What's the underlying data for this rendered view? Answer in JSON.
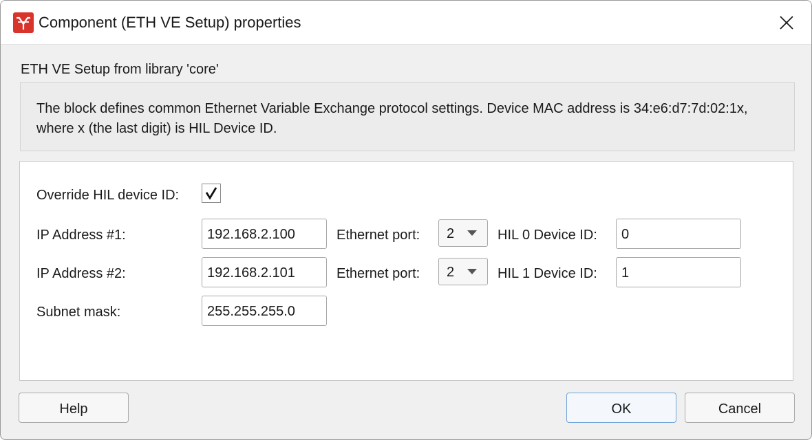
{
  "window": {
    "title": "Component (ETH VE Setup) properties",
    "library_label": "ETH VE Setup from library 'core'",
    "description": "The block defines common Ethernet Variable Exchange protocol settings. Device MAC address is 34:e6:d7:7d:02:1x, where x (the last digit) is HIL Device ID.",
    "icons": {
      "app": "typhoon-logo-icon",
      "close": "close-icon",
      "check": "checkmark-icon",
      "dropdown": "chevron-down-icon"
    },
    "colors": {
      "app_icon": "#d9342b",
      "default_button_border": "#6fa3d8"
    }
  },
  "form": {
    "override_label": "Override HIL device ID:",
    "override_checked": true,
    "ip1": {
      "label": "IP Address #1:",
      "value": "192.168.2.100"
    },
    "ip2": {
      "label": "IP Address #2:",
      "value": "192.168.2.101"
    },
    "subnet": {
      "label": "Subnet mask:",
      "value": "255.255.255.0"
    },
    "port1": {
      "label": "Ethernet port:",
      "value": "2"
    },
    "port2": {
      "label": "Ethernet port:",
      "value": "2"
    },
    "hil0": {
      "label": "HIL 0 Device ID:",
      "value": "0"
    },
    "hil1": {
      "label": "HIL 1 Device ID:",
      "value": "1"
    }
  },
  "buttons": {
    "help": "Help",
    "ok": "OK",
    "cancel": "Cancel"
  }
}
